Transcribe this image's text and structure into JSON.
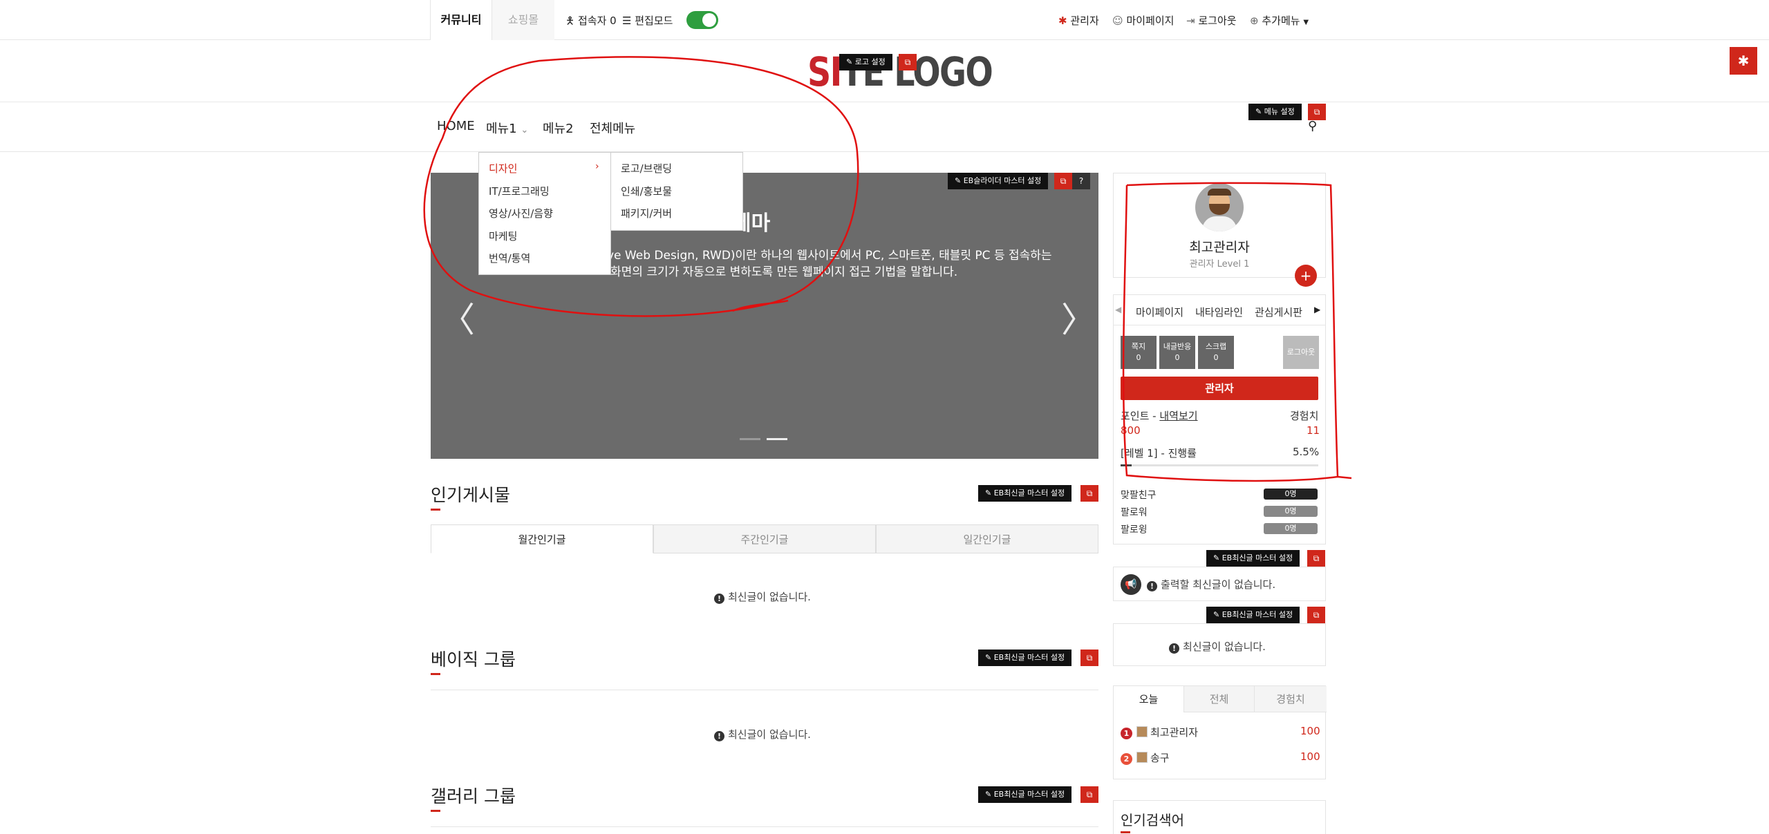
{
  "topbar": {
    "tab_community": "커뮤니티",
    "tab_shop": "쇼핑몰",
    "visitors": "접속자 0",
    "edit_mode": "편집모드",
    "admin": "관리자",
    "mypage": "마이페이지",
    "logout": "로그아웃",
    "more_menu": "추가메뉴"
  },
  "logo": {
    "text_red": "SI",
    "text_mid": "TE L",
    "text_end": "OGO",
    "setting_label": "로고 설정"
  },
  "nav": {
    "items": [
      "HOME",
      "메뉴1",
      "메뉴2",
      "전체메뉴"
    ],
    "menu_setting": "메뉴 설정"
  },
  "dropdown": {
    "items": [
      "디자인",
      "IT/프로그래밍",
      "영상/사진/음향",
      "마케팅",
      "번역/통역"
    ],
    "sub_items": [
      "로고/브랜딩",
      "인쇄/홍보물",
      "패키지/커버"
    ]
  },
  "slider": {
    "setting_label": "EB슬라이더 마스터 설정",
    "title": "테마",
    "desc_line1": "ve Web Design, RWD)이란 하나의 웹사이트에서 PC, 스마트폰, 태블릿 PC 등 접속하는",
    "desc_line2": "화면의 크기가 자동으로 변하도록 만든 웹페이지 접근 기법을 말합니다."
  },
  "sections": {
    "popular_title": "인기게시물",
    "latest_setting": "EB최신글 마스터 설정",
    "tabs": [
      "월간인기글",
      "주간인기글",
      "일간인기글"
    ],
    "empty_text": "최신글이 없습니다.",
    "basic_group_title": "베이직 그룹",
    "gallery_group_title": "갤러리 그룹"
  },
  "profile": {
    "name": "최고관리자",
    "level": "관리자 Level 1",
    "tabs": [
      "마이페이지",
      "내타임라인",
      "관심게시판"
    ],
    "stats": [
      {
        "label": "쪽지",
        "value": "0"
      },
      {
        "label": "내글반응",
        "value": "0"
      },
      {
        "label": "스크랩",
        "value": "0"
      }
    ],
    "logout_btn": "로그아웃",
    "admin_btn": "관리자",
    "point_label": "포인트 - ",
    "point_link": "내역보기",
    "exp_label": "경험치",
    "point_value": "800",
    "exp_value": "11",
    "progress_label": "[레벨 1] - 진행률",
    "progress_value": "5.5%",
    "progress_fraction": 0.055,
    "friends": [
      {
        "label": "맞팔친구",
        "value": "0명"
      },
      {
        "label": "팔로워",
        "value": "0명"
      },
      {
        "label": "팔로윙",
        "value": "0명"
      }
    ]
  },
  "side": {
    "notice_empty": "출력할 최신글이 없습니다.",
    "latest_setting": "EB최신글 마스터 설정",
    "empty_text": "최신글이 없습니다.",
    "rank_tabs": [
      "오늘",
      "전체",
      "경험치"
    ],
    "ranks": [
      {
        "num": "1",
        "name": "최고관리자",
        "score": "100"
      },
      {
        "num": "2",
        "name": "송구",
        "score": "100"
      }
    ],
    "popular_search": "인기검색어"
  },
  "colors": {
    "accent": "#d0271b",
    "toggle_on": "#2e9e3f",
    "annotation": "#e01010"
  }
}
